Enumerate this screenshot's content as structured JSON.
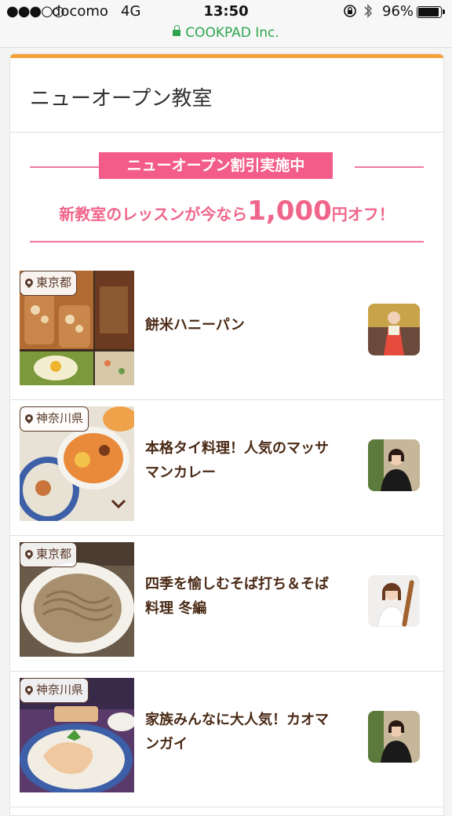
{
  "status_bar": {
    "signal": "●●●○○",
    "carrier": "docomo",
    "network": "4G",
    "time": "13:50",
    "battery": "96%",
    "url": "COOKPAD Inc."
  },
  "section_title": "ニューオープン教室",
  "banner": {
    "ribbon": "ニューオープン割引実施中",
    "promo_prefix": "新教室のレッスンが今なら",
    "promo_amount": "1,000",
    "promo_suffix": "円オフ！"
  },
  "classes": [
    {
      "location": "東京都",
      "name": "餅米ハニーパン"
    },
    {
      "location": "神奈川県",
      "name": "本格タイ料理！人気のマッサマンカレー"
    },
    {
      "location": "東京都",
      "name": "四季を愉しむそば打ち＆そば料理 冬編"
    },
    {
      "location": "神奈川県",
      "name": "家族みんなに大人気！カオマンガイ"
    }
  ],
  "colors": {
    "accent": "#f5a23a",
    "pink": "#f35c89",
    "url_green": "#2ea44f",
    "text_brown": "#4a2a16"
  }
}
